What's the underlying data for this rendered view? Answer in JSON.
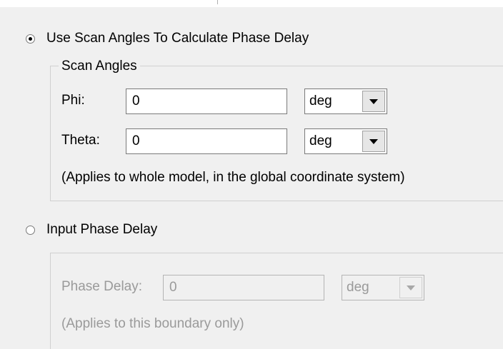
{
  "scan_option": {
    "label": "Use Scan Angles To Calculate Phase Delay",
    "selected": true
  },
  "scan_angles": {
    "group_title": "Scan Angles",
    "phi_label": "Phi:",
    "phi_value": "0",
    "phi_unit": "deg",
    "theta_label": "Theta:",
    "theta_value": "0",
    "theta_unit": "deg",
    "note": "(Applies to whole model, in the global coordinate system)"
  },
  "input_option": {
    "label": "Input Phase Delay",
    "selected": false
  },
  "phase_delay": {
    "label": "Phase Delay:",
    "value": "0",
    "unit": "deg",
    "note": "(Applies to this boundary only)",
    "enabled": false
  },
  "icons": {
    "dropdown": "chevron-down-icon",
    "radio": "radio-button-icon"
  },
  "colors": {
    "background": "#f0f0f0",
    "disabled_text": "#9a9a9a",
    "border": "#7a7a7a"
  }
}
